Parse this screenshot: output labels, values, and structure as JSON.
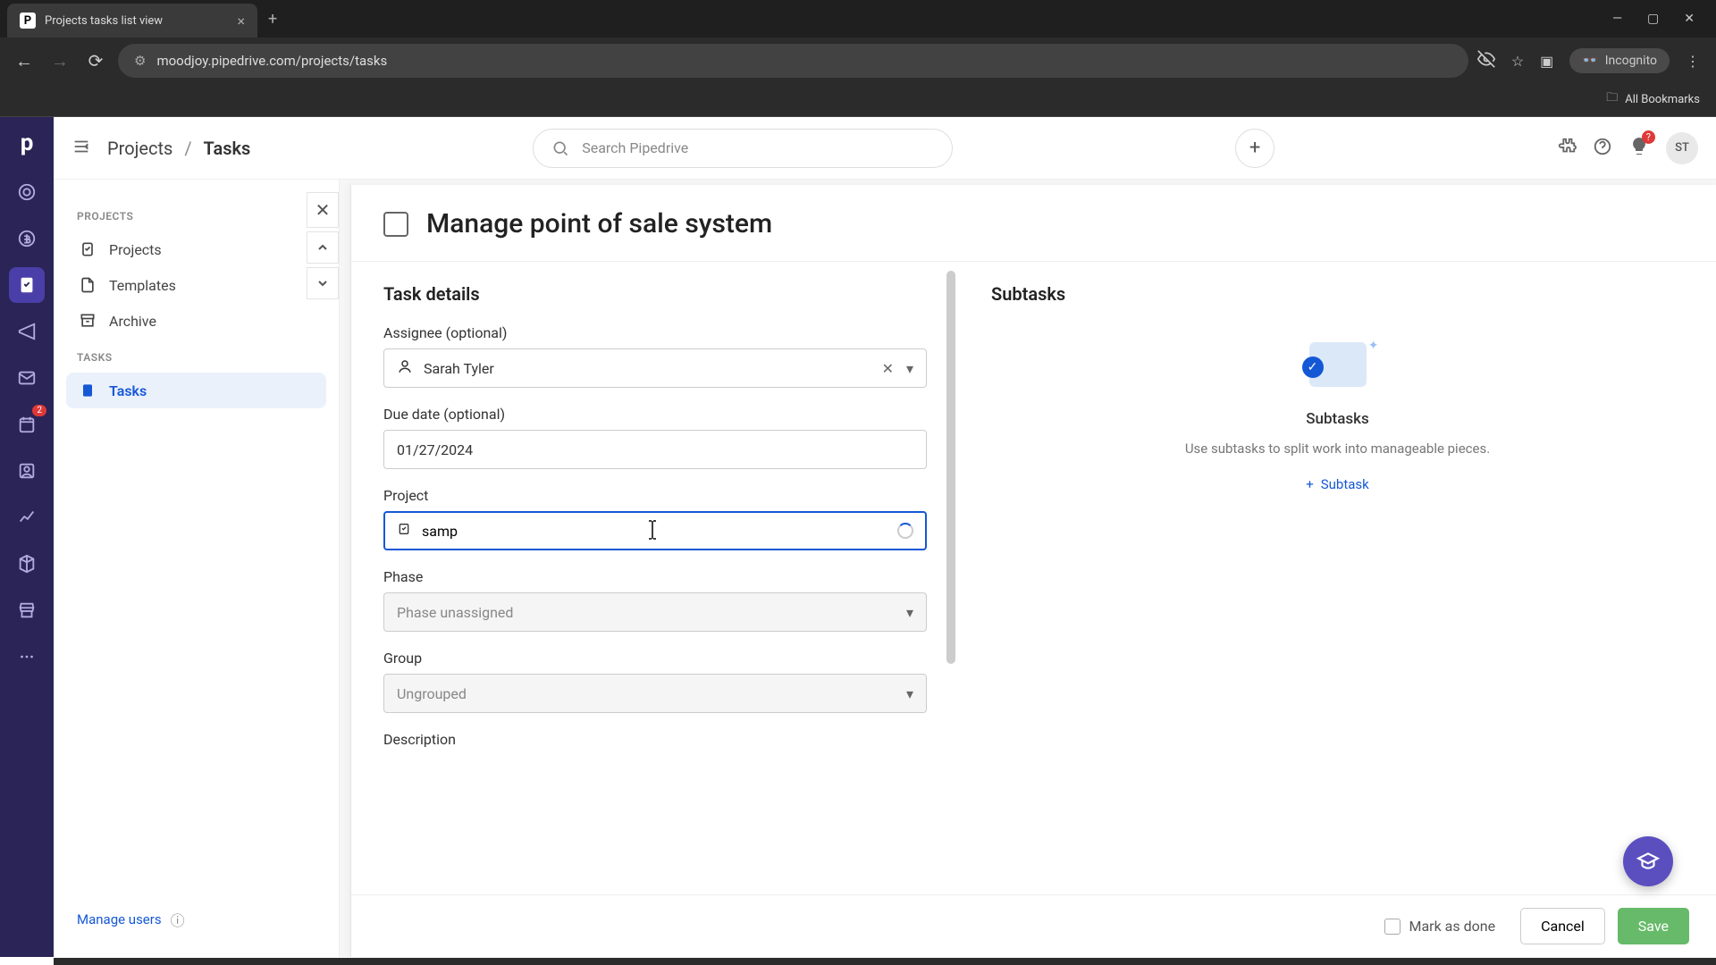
{
  "browser": {
    "tab_title": "Projects tasks list view",
    "url": "moodjoy.pipedrive.com/projects/tasks",
    "incognito_label": "Incognito",
    "bookmarks_label": "All Bookmarks"
  },
  "topbar": {
    "breadcrumb_parent": "Projects",
    "breadcrumb_current": "Tasks",
    "search_placeholder": "Search Pipedrive",
    "avatar_initials": "ST",
    "tip_badge": "?"
  },
  "sidebar": {
    "section1": "PROJECTS",
    "projects": "Projects",
    "templates": "Templates",
    "archive": "Archive",
    "section2": "TASKS",
    "tasks": "Tasks",
    "manage_users": "Manage users"
  },
  "vrail": {
    "badge": "2"
  },
  "panel": {
    "task_title": "Manage point of sale system",
    "details_heading": "Task details",
    "assignee_label": "Assignee (optional)",
    "assignee_value": "Sarah Tyler",
    "due_label": "Due date (optional)",
    "due_value": "01/27/2024",
    "project_label": "Project",
    "project_value": "samp",
    "phase_label": "Phase",
    "phase_value": "Phase unassigned",
    "group_label": "Group",
    "group_value": "Ungrouped",
    "description_label": "Description",
    "mark_done": "Mark as done",
    "cancel": "Cancel",
    "save": "Save"
  },
  "subtasks": {
    "heading": "Subtasks",
    "empty_title": "Subtasks",
    "empty_desc": "Use subtasks to split work into manageable pieces.",
    "add_label": "Subtask"
  }
}
